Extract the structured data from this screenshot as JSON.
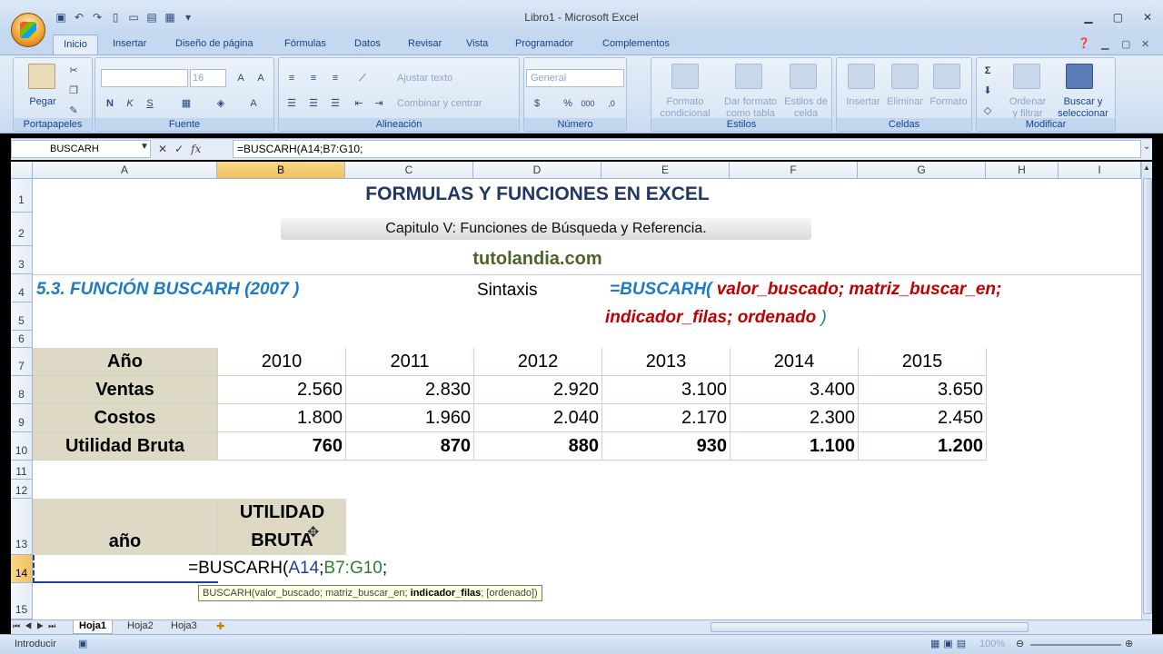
{
  "app": {
    "title": "Libro1",
    "app_name": "Microsoft Excel",
    "separator": " - "
  },
  "ribbon_tabs": [
    "Inicio",
    "Insertar",
    "Diseño de página",
    "Fórmulas",
    "Datos",
    "Revisar",
    "Vista",
    "Programador",
    "Complementos"
  ],
  "ribbon": {
    "portapapeles": {
      "label": "Portapapeles",
      "pegar": "Pegar"
    },
    "fuente": {
      "label": "Fuente",
      "font_name": "",
      "font_size": "16",
      "bold": "N",
      "italic": "K",
      "underline": "S"
    },
    "alineacion": {
      "label": "Alineación",
      "ajustar": "Ajustar texto",
      "combinar": "Combinar y centrar"
    },
    "numero": {
      "label": "Número",
      "format": "General",
      "currency": "$",
      "percent": "%",
      "thousands": "000"
    },
    "estilos": {
      "label": "Estilos",
      "formato_condicional": [
        "Formato",
        "condicional"
      ],
      "dar_formato": [
        "Dar formato",
        "como tabla"
      ],
      "estilos_celda": [
        "Estilos de",
        "celda"
      ]
    },
    "celdas": {
      "label": "Celdas",
      "insertar": "Insertar",
      "eliminar": "Eliminar",
      "formato": "Formato"
    },
    "modificar": {
      "label": "Modificar",
      "sigma": "Σ",
      "ordenar": [
        "Ordenar",
        "y filtrar"
      ],
      "buscar": [
        "Buscar y",
        "seleccionar"
      ]
    }
  },
  "formula_bar": {
    "name_box": "BUSCARH",
    "fx": "fx",
    "formula": "=BUSCARH(A14;B7:G10;"
  },
  "columns": [
    "A",
    "B",
    "C",
    "D",
    "E",
    "F",
    "G",
    "H",
    "I"
  ],
  "rows": [
    "1",
    "2",
    "3",
    "4",
    "5",
    "6",
    "7",
    "8",
    "9",
    "10",
    "11",
    "12",
    "13",
    "14",
    "15"
  ],
  "sheet": {
    "title": "FORMULAS Y FUNCIONES EN EXCEL",
    "subtitle": "Capitulo V: Funciones de Búsqueda y Referencia.",
    "site": "tutolandia.com",
    "section": "5.3. FUNCIÓN BUSCARH (2007 )",
    "sintaxis_label": "Sintaxis",
    "syntax_fn": "=BUSCARH(",
    "syntax_args1": " valor_buscado; matriz_buscar_en;",
    "syntax_args2": "indicador_filas; ordenado",
    "syntax_close": " )",
    "table": {
      "header": [
        "Año",
        "2010",
        "2011",
        "2012",
        "2013",
        "2014",
        "2015"
      ],
      "rows": [
        [
          "Ventas",
          "2.560",
          "2.830",
          "2.920",
          "3.100",
          "3.400",
          "3.650"
        ],
        [
          "Costos",
          "1.800",
          "1.960",
          "2.040",
          "2.170",
          "2.300",
          "2.450"
        ],
        [
          "Utilidad Bruta",
          "760",
          "870",
          "880",
          "930",
          "1.100",
          "1.200"
        ]
      ]
    },
    "lookup_header": {
      "year": "año",
      "utilidad1": "UTILIDAD",
      "utilidad2": "BRUTA"
    },
    "editing": {
      "fn": "=BUSCARH(",
      "ref1": "A14",
      "sep1": ";",
      "ref2": "B7:G10",
      "sep2": ";"
    }
  },
  "tooltip": {
    "prefix": "BUSCARH(valor_buscado; matriz_buscar_en; ",
    "current": "indicador_filas",
    "suffix": "; [ordenado])"
  },
  "sheet_tabs": [
    "Hoja1",
    "Hoja2",
    "Hoja3"
  ],
  "status": {
    "mode": "Introducir",
    "zoom": "100%"
  },
  "colors": {
    "title": "#1f3864",
    "site": "#4f6228",
    "section": "#1f7ac4",
    "syntax_fn": "#1f7ac4",
    "syntax_args": "#c00000",
    "ref1": "#1f3fa0",
    "ref2": "#2e7d32",
    "table_header_bg": "#ddd9c4"
  }
}
